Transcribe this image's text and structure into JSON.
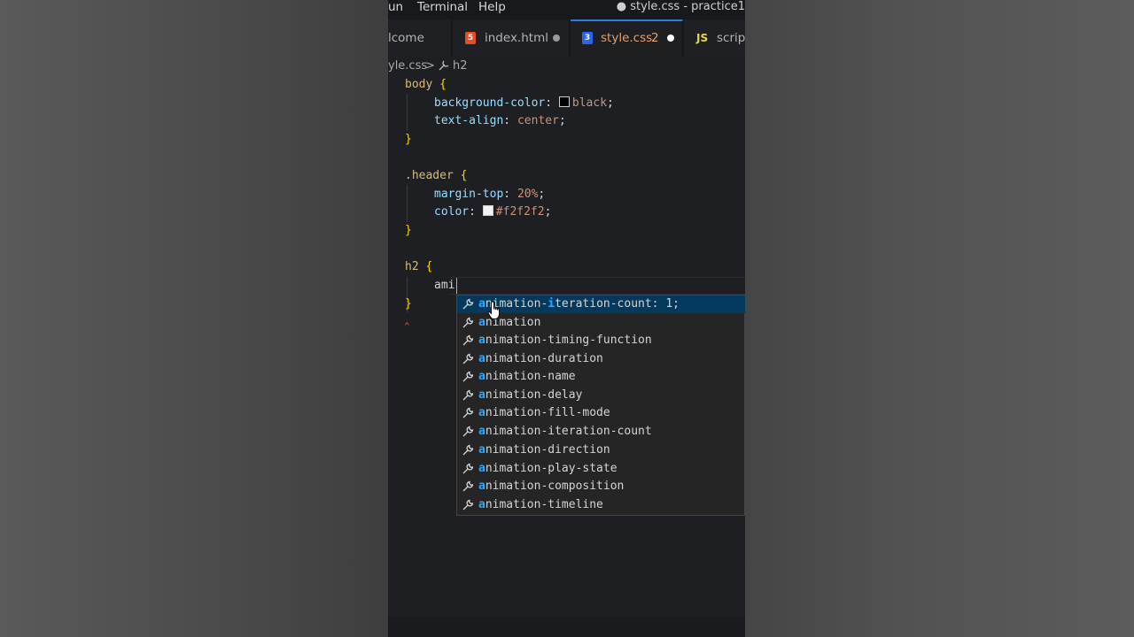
{
  "menu": {
    "items": [
      "un",
      "Terminal",
      "Help"
    ],
    "window_title": "● style.css - practice1"
  },
  "tabs": [
    {
      "label": "lcome",
      "icon": "welcome-icon"
    },
    {
      "label": "index.html",
      "icon": "html5-icon",
      "icon_text": "5",
      "modified": true
    },
    {
      "label": "style.css",
      "problems": "2",
      "icon": "css3-icon",
      "icon_text": "3",
      "modified": true,
      "active": true
    },
    {
      "label": "script",
      "icon": "js-icon",
      "icon_text": "JS"
    }
  ],
  "breadcrumb": {
    "file": "yle.css",
    "separator": ">",
    "symbol": "h2"
  },
  "code": {
    "l1_sel": "body",
    "open": "{",
    "close": "}",
    "l2_prop": "background-color",
    "l2_val": "black",
    "l3_prop": "text-align",
    "l3_val": "center",
    "l5_sel": ".header",
    "l6_prop": "margin-top",
    "l6_val": "20%",
    "l7_prop": "color",
    "l7_val": "#f2f2f2",
    "l9_sel": "h2",
    "l10_typed": "ami",
    "colon": ":",
    "semi": ";"
  },
  "colors": {
    "swatch_black": "#000000",
    "swatch_f2": "#f2f2f2",
    "accent": "#2aaaff",
    "focused_bg": "#04395e"
  },
  "suggest": {
    "match_a": "a",
    "match_mi": "mi",
    "items": [
      {
        "pre": "nimation-",
        "mid": "i",
        "post": "teration-count: 1;"
      },
      {
        "rest": "nimation"
      },
      {
        "rest": "nimation-timing-function"
      },
      {
        "rest": "nimation-duration"
      },
      {
        "rest": "nimation-name"
      },
      {
        "rest": "nimation-delay"
      },
      {
        "rest": "nimation-fill-mode"
      },
      {
        "rest": "nimation-iteration-count"
      },
      {
        "rest": "nimation-direction"
      },
      {
        "rest": "nimation-play-state"
      },
      {
        "rest": "nimation-composition"
      },
      {
        "rest": "nimation-timeline"
      }
    ]
  }
}
